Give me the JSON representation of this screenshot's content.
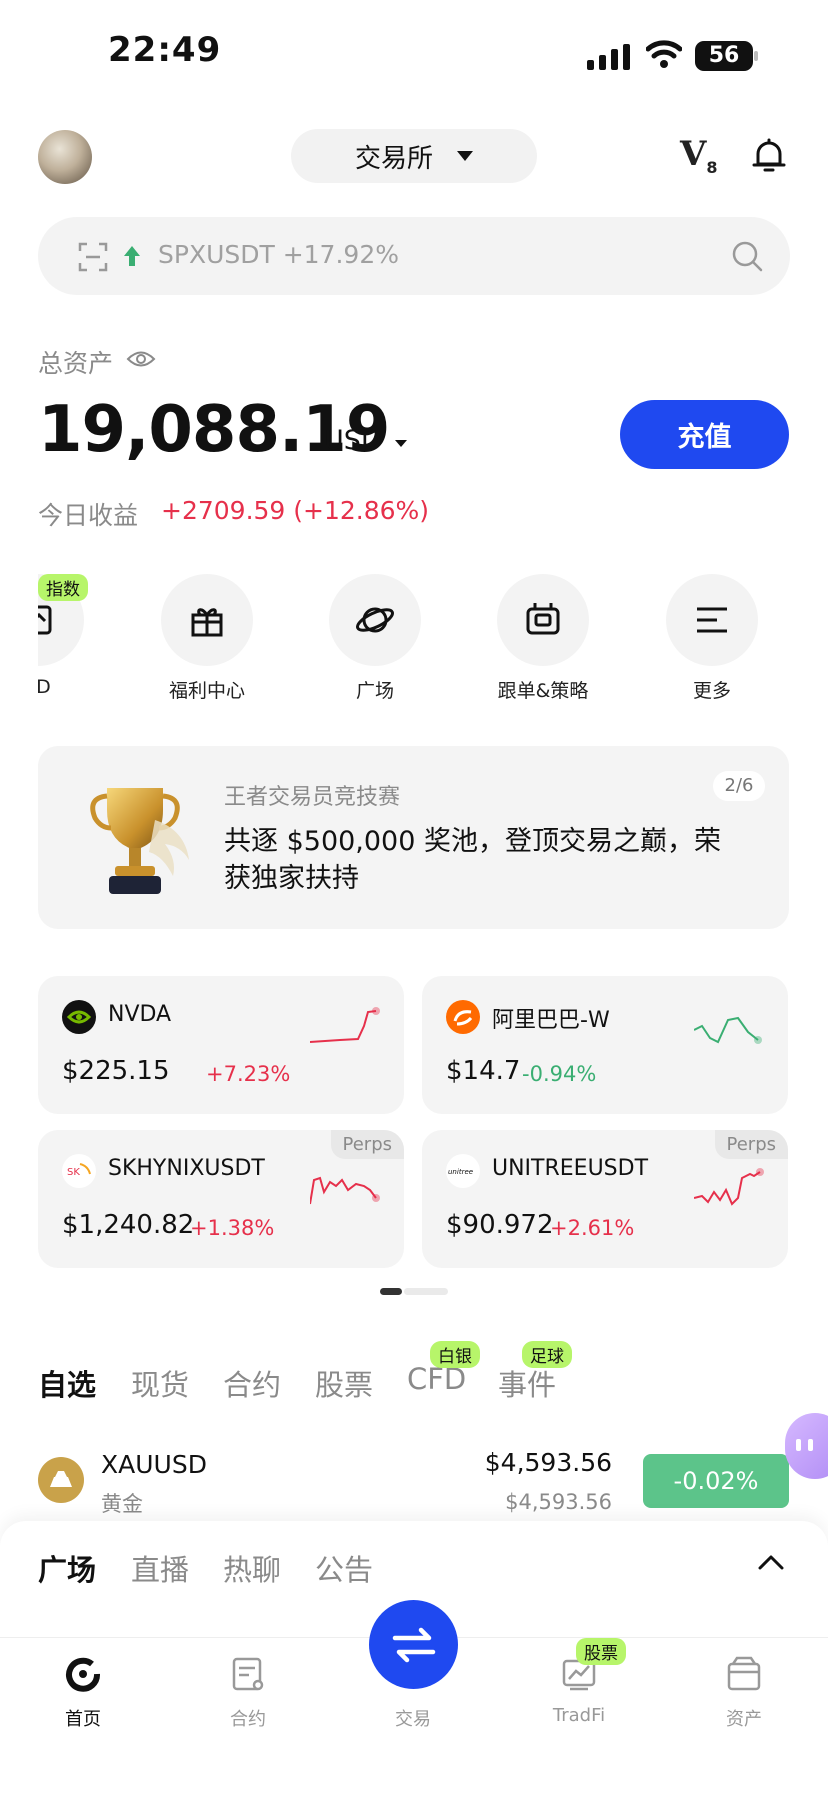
{
  "status_bar": {
    "time": "22:49",
    "battery": "56"
  },
  "header": {
    "exchange_label": "交易所",
    "vip_label": "V",
    "vip_level": "8"
  },
  "search": {
    "hint_symbol": "SPXUSDT +17.92%"
  },
  "assets": {
    "label": "总资产",
    "value": "19,088.19",
    "unit": "USD",
    "deposit_label": "充值",
    "pnl_label": "今日收益",
    "pnl_value": "+2709.59 (+12.86%)"
  },
  "quick_actions": {
    "badge": "指数",
    "items": [
      {
        "label": "FD",
        "icon": "cfd-icon"
      },
      {
        "label": "福利中心",
        "icon": "gift-icon"
      },
      {
        "label": "广场",
        "icon": "planet-icon"
      },
      {
        "label": "跟单&策略",
        "icon": "bot-icon"
      },
      {
        "label": "更多",
        "icon": "menu-icon"
      }
    ]
  },
  "banner": {
    "title": "王者交易员竞技赛",
    "body": "共逐 $500,000 奖池，登顶交易之巅，荣获独家扶持",
    "page": "2/6"
  },
  "tickers": [
    {
      "symbol": "NVDA",
      "price": "$225.15",
      "change": "+7.23%",
      "direction": "up",
      "tag": ""
    },
    {
      "symbol": "阿里巴巴-W",
      "price": "$14.7",
      "change": "-0.94%",
      "direction": "down",
      "tag": ""
    },
    {
      "symbol": "SKHYNIXUSDT",
      "price": "$1,240.82",
      "change": "+1.38%",
      "direction": "up",
      "tag": "Perps"
    },
    {
      "symbol": "UNITREEUSDT",
      "price": "$90.972",
      "change": "+2.61%",
      "direction": "up",
      "tag": "Perps"
    }
  ],
  "market_tabs": {
    "items": [
      "自选",
      "现货",
      "合约",
      "股票",
      "CFD",
      "事件"
    ],
    "badges": {
      "cfd": "白银",
      "events": "足球"
    }
  },
  "watchlist": [
    {
      "symbol": "XAUUSD",
      "name": "黄金",
      "price": "$4,593.56",
      "sub_price": "$4,593.56",
      "change": "-0.02%"
    }
  ],
  "sheet_tabs": [
    "广场",
    "直播",
    "热聊",
    "公告"
  ],
  "nav": {
    "items": [
      "首页",
      "合约",
      "交易",
      "TradFi",
      "资产"
    ],
    "tradfi_badge": "股票"
  },
  "colors": {
    "accent": "#1f49f0",
    "up": "#e6304b",
    "down": "#3aae72",
    "badge": "#b7f56a"
  }
}
